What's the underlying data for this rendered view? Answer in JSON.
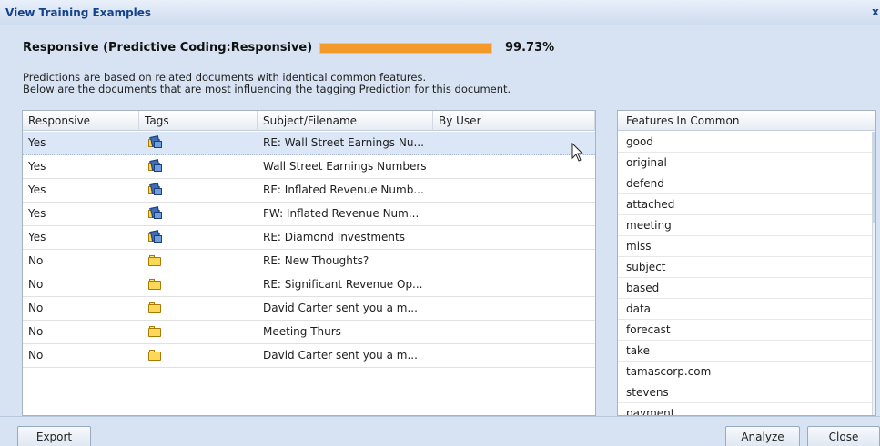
{
  "window": {
    "title": "View Training Examples",
    "close_glyph": "x"
  },
  "prediction": {
    "label": "Responsive (Predictive Coding:Responsive)",
    "percent_text": "99.73%",
    "fraction": 0.9973,
    "bar_color": "#f39a2b"
  },
  "description": {
    "line1": "Predictions are based on related documents with identical common features.",
    "line2": "Below are the documents that are most influencing the tagging Prediction for this document."
  },
  "grid": {
    "columns": [
      "Responsive",
      "Tags",
      "Subject/Filename",
      "By User"
    ],
    "rows": [
      {
        "responsive": "Yes",
        "tag_icon": "tagged-folder-icon",
        "subject": "RE: Wall Street Earnings Nu...",
        "by_user": "",
        "selected": true
      },
      {
        "responsive": "Yes",
        "tag_icon": "tagged-folder-icon",
        "subject": "Wall Street Earnings Numbers",
        "by_user": ""
      },
      {
        "responsive": "Yes",
        "tag_icon": "tagged-folder-icon",
        "subject": "RE: Inflated Revenue Numb...",
        "by_user": ""
      },
      {
        "responsive": "Yes",
        "tag_icon": "tagged-folder-icon",
        "subject": "FW: Inflated Revenue Num...",
        "by_user": ""
      },
      {
        "responsive": "Yes",
        "tag_icon": "tagged-folder-icon",
        "subject": "RE: Diamond Investments",
        "by_user": ""
      },
      {
        "responsive": "No",
        "tag_icon": "folder-icon",
        "subject": "RE: New Thoughts?",
        "by_user": ""
      },
      {
        "responsive": "No",
        "tag_icon": "folder-icon",
        "subject": "RE: Significant Revenue Op...",
        "by_user": ""
      },
      {
        "responsive": "No",
        "tag_icon": "folder-icon",
        "subject": "David Carter sent you a m...",
        "by_user": ""
      },
      {
        "responsive": "No",
        "tag_icon": "folder-icon",
        "subject": "Meeting Thurs",
        "by_user": ""
      },
      {
        "responsive": "No",
        "tag_icon": "folder-icon",
        "subject": "David Carter sent you a m...",
        "by_user": ""
      }
    ]
  },
  "features": {
    "header": "Features In Common",
    "items": [
      "good",
      "original",
      "defend",
      "attached",
      "meeting",
      "miss",
      "subject",
      "based",
      "data",
      "forecast",
      "take",
      "tamascorp.com",
      "stevens",
      "payment"
    ]
  },
  "footer": {
    "export_label": "Export",
    "analyze_label": "Analyze",
    "close_label": "Close"
  }
}
